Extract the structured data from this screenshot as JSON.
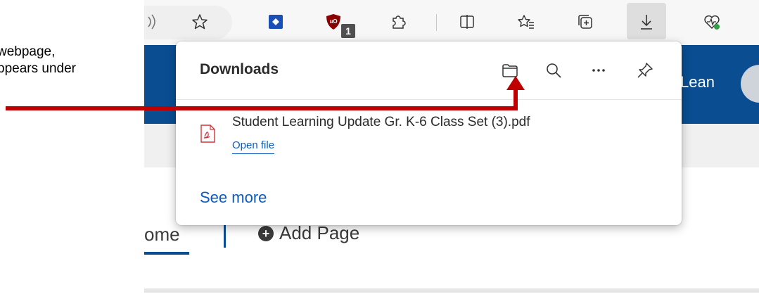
{
  "annotation": {
    "line1": "webpage,",
    "line2": "ppears under"
  },
  "toolbar": {
    "extension_badge": "1",
    "icons": [
      "read-aloud-icon",
      "favorite-star-icon",
      "extension-shield-icon",
      "ublock-icon",
      "puzzle-extensions-icon",
      "split-screen-icon",
      "favorites-list-icon",
      "collections-icon",
      "downloads-icon",
      "browser-essentials-icon"
    ]
  },
  "page": {
    "header_name_fragment": "Lean",
    "nav_home": "ome",
    "nav_add_page": "Add Page"
  },
  "downloads": {
    "title": "Downloads",
    "items": [
      {
        "file_name": "Student Learning Update Gr. K-6 Class Set (3).pdf",
        "action": "Open file"
      }
    ],
    "see_more": "See more"
  },
  "colors": {
    "brand_blue": "#0a4d91",
    "link_blue": "#0a5ac2",
    "arrow_red": "#c00000"
  }
}
